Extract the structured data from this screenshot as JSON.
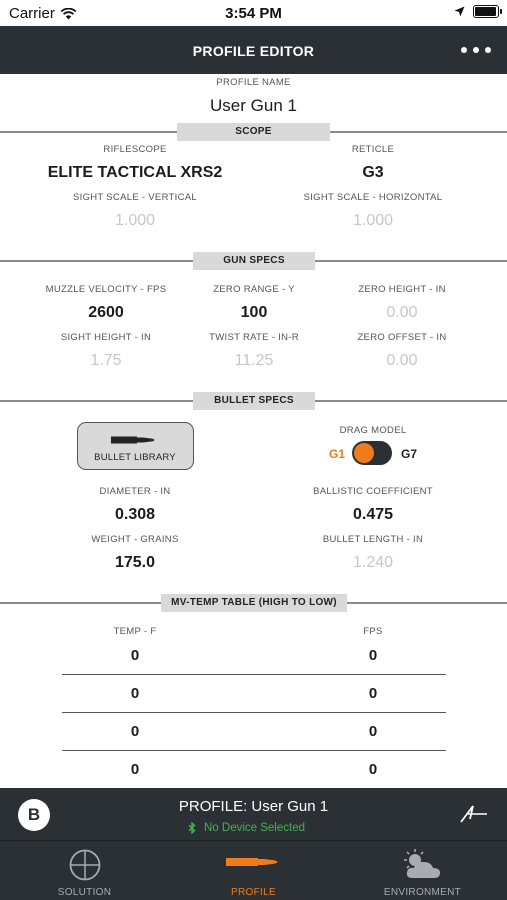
{
  "status_bar": {
    "carrier": "Carrier",
    "time": "3:54 PM"
  },
  "header": {
    "title": "PROFILE EDITOR",
    "menu_icon": "more-dots-icon"
  },
  "profile": {
    "name_label": "PROFILE NAME",
    "name_value": "User Gun 1"
  },
  "scope": {
    "section_title": "SCOPE",
    "riflescope_label": "RIFLESCOPE",
    "riflescope_value": "ELITE TACTICAL XRS2",
    "reticle_label": "RETICLE",
    "reticle_value": "G3",
    "sight_scale_vertical_label": "SIGHT SCALE - VERTICAL",
    "sight_scale_vertical_value": "1.000",
    "sight_scale_horizontal_label": "SIGHT SCALE - HORIZONTAL",
    "sight_scale_horizontal_value": "1.000"
  },
  "gun_specs": {
    "section_title": "GUN SPECS",
    "muzzle_velocity_label": "MUZZLE VELOCITY - FPS",
    "muzzle_velocity_value": "2600",
    "zero_range_label": "ZERO RANGE - Y",
    "zero_range_value": "100",
    "zero_height_label": "ZERO HEIGHT - IN",
    "zero_height_value": "0.00",
    "sight_height_label": "SIGHT HEIGHT - IN",
    "sight_height_value": "1.75",
    "twist_rate_label": "TWIST RATE - IN-R",
    "twist_rate_value": "11.25",
    "zero_offset_label": "ZERO OFFSET - IN",
    "zero_offset_value": "0.00"
  },
  "bullet_specs": {
    "section_title": "BULLET SPECS",
    "bullet_library_label": "BULLET LIBRARY",
    "drag_model_label": "DRAG MODEL",
    "drag_g1": "G1",
    "drag_g7": "G7",
    "drag_selected": "G1",
    "diameter_label": "DIAMETER - IN",
    "diameter_value": "0.308",
    "ballistic_coefficient_label": "BALLISTIC COEFFICIENT",
    "ballistic_coefficient_value": "0.475",
    "weight_label": "WEIGHT - GRAINS",
    "weight_value": "175.0",
    "bullet_length_label": "BULLET LENGTH - IN",
    "bullet_length_value": "1.240"
  },
  "mv_temp_table": {
    "section_title": "MV-TEMP TABLE (HIGH TO LOW)",
    "columns": [
      "TEMP - F",
      "FPS"
    ],
    "rows": [
      [
        "0",
        "0"
      ],
      [
        "0",
        "0"
      ],
      [
        "0",
        "0"
      ],
      [
        "0",
        "0"
      ]
    ]
  },
  "profile_bar": {
    "profile_text": "PROFILE: User Gun 1",
    "device_status": "No Device Selected",
    "brand_letter": "B"
  },
  "tabs": [
    {
      "label": "SOLUTION",
      "icon": "crosshair-icon",
      "active": false
    },
    {
      "label": "PROFILE",
      "icon": "bullet-icon",
      "active": true
    },
    {
      "label": "ENVIRONMENT",
      "icon": "weather-icon",
      "active": false
    }
  ],
  "colors": {
    "header_bg": "#2b3035",
    "accent": "#f07c19",
    "bluetooth_green": "#3fb64a",
    "section_badge_bg": "#d9d9d9",
    "muted_value": "#c7c7c7"
  }
}
